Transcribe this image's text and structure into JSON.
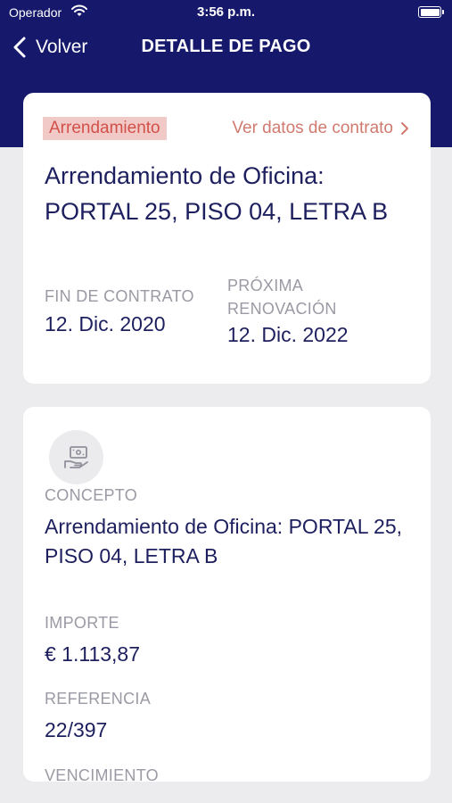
{
  "status_bar": {
    "carrier": "Operador",
    "time": "3:56 p.m."
  },
  "nav": {
    "back_label": "Volver",
    "title": "DETALLE DE PAGO"
  },
  "contract_card": {
    "badge": "Arrendamiento",
    "link_label": "Ver datos de contrato",
    "title": "Arrendamiento de Oficina: PORTAL 25, PISO 04, LETRA B",
    "end_label": "FIN DE CONTRATO",
    "end_value": "12. Dic. 2020",
    "renewal_label": "PRÓXIMA RENOVACIÓN",
    "renewal_value": "12. Dic. 2022"
  },
  "payment_card": {
    "icon": "payment-icon",
    "concept_label": "CONCEPTO",
    "concept_value": "Arrendamiento de Oficina: PORTAL 25, PISO 04, LETRA B",
    "amount_label": "IMPORTE",
    "amount_value": "€ 1.113,87",
    "reference_label": "REFERENCIA",
    "reference_value": "22/397",
    "due_label": "VENCIMIENTO"
  },
  "colors": {
    "header": "#16196b",
    "text_primary": "#1d1f5e",
    "badge_bg": "#f1c9c6",
    "badge_text": "#d2504a",
    "link": "#d07a6f",
    "label": "#9a9aa4"
  }
}
